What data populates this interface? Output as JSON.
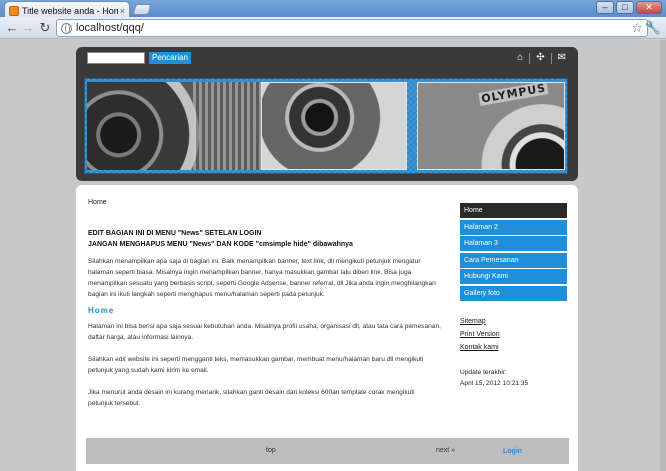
{
  "browser": {
    "tab_title": "Title website anda - Home",
    "tab_close": "×",
    "url": "localhost/qqq/",
    "back_icon": "back-arrow-icon",
    "forward_icon": "forward-arrow-icon",
    "reload_icon": "reload-icon",
    "window_buttons": [
      "–",
      "□",
      "✕"
    ]
  },
  "topbar": {
    "search_placeholder": "",
    "search_button": "Pencarian",
    "icons": [
      "home-icon",
      "sitemap-icon",
      "mail-icon"
    ]
  },
  "header": {
    "banner_brand": "OLYMPUS"
  },
  "breadcrumb": "Home",
  "notice": {
    "line1": "EDIT BAGIAN INI DI MENU \"News\" SETELAN LOGIN",
    "line2": "JANGAN MENGHAPUS MENU \"News\" DAN KODE \"cmsimple hide\" dibawahnya"
  },
  "intro_paragraph": "Silahkan menampilkan apa saja di bagian ini. Baik menampilkan banner, text link, dll mengikuti petunjuk mengatur halaman seperti biasa. Misalnya ingin menampilkan banner, hanya masukkan gambar lalu diberi link. Bisa juga menampilkan sesuatu yang berbasis script, seperti Google Adsense, banner referral, dll Jika anda ingin menghilangkan bagian ini ikuti langkah seperti menghapus menu/halaman seperti pada petunjuk.",
  "section_title": "Home",
  "body_paragraphs": [
    "Halaman ini bisa berisi apa saja sesuai kebutuhan anda. Misalnya profil usaha, organisasi dll, atau tata cara pemesanan, daftar harga, atau informasi lainnya.",
    "Silahkan edit website ini seperti mengganti teks, memasukkan gambar, membuat menu/halaman baru dll mengikuti petunjuk yang sudah kami kirim ke email.",
    "Jika menurut anda desain ini kurang menarik, silahkan ganti desain dari koleksi 600an template corak mengikuti petunjuk tersebut."
  ],
  "menu": {
    "items": [
      {
        "label": "Home",
        "active": true
      },
      {
        "label": "Halaman 2",
        "active": false
      },
      {
        "label": "Halaman 3",
        "active": false
      },
      {
        "label": "Cara Pemesanan",
        "active": false
      },
      {
        "label": "Hubungi Kami",
        "active": false
      },
      {
        "label": "Gallery foto",
        "active": false
      }
    ]
  },
  "sidelinks": [
    "Sitemap",
    "Print Version",
    "Kontak kami"
  ],
  "updated": {
    "label": "Update terakhir:",
    "value": "April 15, 2012 10:21:35"
  },
  "footer": {
    "top": "top",
    "next": "next »",
    "login": "Login"
  },
  "colors": {
    "accent": "#1e8fd8",
    "dark": "#3a3a3a",
    "menu_active": "#2a2a2a"
  }
}
